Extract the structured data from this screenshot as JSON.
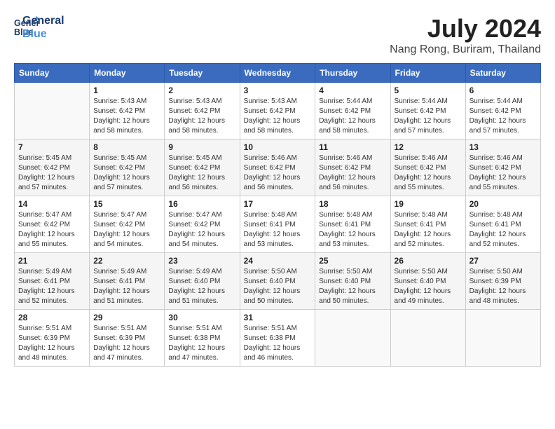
{
  "header": {
    "logo_line1": "General",
    "logo_line2": "Blue",
    "month_year": "July 2024",
    "location": "Nang Rong, Buriram, Thailand"
  },
  "columns": [
    "Sunday",
    "Monday",
    "Tuesday",
    "Wednesday",
    "Thursday",
    "Friday",
    "Saturday"
  ],
  "weeks": [
    [
      {
        "day": "",
        "sunrise": "",
        "sunset": "",
        "daylight": ""
      },
      {
        "day": "1",
        "sunrise": "Sunrise: 5:43 AM",
        "sunset": "Sunset: 6:42 PM",
        "daylight": "Daylight: 12 hours and 58 minutes."
      },
      {
        "day": "2",
        "sunrise": "Sunrise: 5:43 AM",
        "sunset": "Sunset: 6:42 PM",
        "daylight": "Daylight: 12 hours and 58 minutes."
      },
      {
        "day": "3",
        "sunrise": "Sunrise: 5:43 AM",
        "sunset": "Sunset: 6:42 PM",
        "daylight": "Daylight: 12 hours and 58 minutes."
      },
      {
        "day": "4",
        "sunrise": "Sunrise: 5:44 AM",
        "sunset": "Sunset: 6:42 PM",
        "daylight": "Daylight: 12 hours and 58 minutes."
      },
      {
        "day": "5",
        "sunrise": "Sunrise: 5:44 AM",
        "sunset": "Sunset: 6:42 PM",
        "daylight": "Daylight: 12 hours and 57 minutes."
      },
      {
        "day": "6",
        "sunrise": "Sunrise: 5:44 AM",
        "sunset": "Sunset: 6:42 PM",
        "daylight": "Daylight: 12 hours and 57 minutes."
      }
    ],
    [
      {
        "day": "7",
        "sunrise": "Sunrise: 5:45 AM",
        "sunset": "Sunset: 6:42 PM",
        "daylight": "Daylight: 12 hours and 57 minutes."
      },
      {
        "day": "8",
        "sunrise": "Sunrise: 5:45 AM",
        "sunset": "Sunset: 6:42 PM",
        "daylight": "Daylight: 12 hours and 57 minutes."
      },
      {
        "day": "9",
        "sunrise": "Sunrise: 5:45 AM",
        "sunset": "Sunset: 6:42 PM",
        "daylight": "Daylight: 12 hours and 56 minutes."
      },
      {
        "day": "10",
        "sunrise": "Sunrise: 5:46 AM",
        "sunset": "Sunset: 6:42 PM",
        "daylight": "Daylight: 12 hours and 56 minutes."
      },
      {
        "day": "11",
        "sunrise": "Sunrise: 5:46 AM",
        "sunset": "Sunset: 6:42 PM",
        "daylight": "Daylight: 12 hours and 56 minutes."
      },
      {
        "day": "12",
        "sunrise": "Sunrise: 5:46 AM",
        "sunset": "Sunset: 6:42 PM",
        "daylight": "Daylight: 12 hours and 55 minutes."
      },
      {
        "day": "13",
        "sunrise": "Sunrise: 5:46 AM",
        "sunset": "Sunset: 6:42 PM",
        "daylight": "Daylight: 12 hours and 55 minutes."
      }
    ],
    [
      {
        "day": "14",
        "sunrise": "Sunrise: 5:47 AM",
        "sunset": "Sunset: 6:42 PM",
        "daylight": "Daylight: 12 hours and 55 minutes."
      },
      {
        "day": "15",
        "sunrise": "Sunrise: 5:47 AM",
        "sunset": "Sunset: 6:42 PM",
        "daylight": "Daylight: 12 hours and 54 minutes."
      },
      {
        "day": "16",
        "sunrise": "Sunrise: 5:47 AM",
        "sunset": "Sunset: 6:42 PM",
        "daylight": "Daylight: 12 hours and 54 minutes."
      },
      {
        "day": "17",
        "sunrise": "Sunrise: 5:48 AM",
        "sunset": "Sunset: 6:41 PM",
        "daylight": "Daylight: 12 hours and 53 minutes."
      },
      {
        "day": "18",
        "sunrise": "Sunrise: 5:48 AM",
        "sunset": "Sunset: 6:41 PM",
        "daylight": "Daylight: 12 hours and 53 minutes."
      },
      {
        "day": "19",
        "sunrise": "Sunrise: 5:48 AM",
        "sunset": "Sunset: 6:41 PM",
        "daylight": "Daylight: 12 hours and 52 minutes."
      },
      {
        "day": "20",
        "sunrise": "Sunrise: 5:48 AM",
        "sunset": "Sunset: 6:41 PM",
        "daylight": "Daylight: 12 hours and 52 minutes."
      }
    ],
    [
      {
        "day": "21",
        "sunrise": "Sunrise: 5:49 AM",
        "sunset": "Sunset: 6:41 PM",
        "daylight": "Daylight: 12 hours and 52 minutes."
      },
      {
        "day": "22",
        "sunrise": "Sunrise: 5:49 AM",
        "sunset": "Sunset: 6:41 PM",
        "daylight": "Daylight: 12 hours and 51 minutes."
      },
      {
        "day": "23",
        "sunrise": "Sunrise: 5:49 AM",
        "sunset": "Sunset: 6:40 PM",
        "daylight": "Daylight: 12 hours and 51 minutes."
      },
      {
        "day": "24",
        "sunrise": "Sunrise: 5:50 AM",
        "sunset": "Sunset: 6:40 PM",
        "daylight": "Daylight: 12 hours and 50 minutes."
      },
      {
        "day": "25",
        "sunrise": "Sunrise: 5:50 AM",
        "sunset": "Sunset: 6:40 PM",
        "daylight": "Daylight: 12 hours and 50 minutes."
      },
      {
        "day": "26",
        "sunrise": "Sunrise: 5:50 AM",
        "sunset": "Sunset: 6:40 PM",
        "daylight": "Daylight: 12 hours and 49 minutes."
      },
      {
        "day": "27",
        "sunrise": "Sunrise: 5:50 AM",
        "sunset": "Sunset: 6:39 PM",
        "daylight": "Daylight: 12 hours and 48 minutes."
      }
    ],
    [
      {
        "day": "28",
        "sunrise": "Sunrise: 5:51 AM",
        "sunset": "Sunset: 6:39 PM",
        "daylight": "Daylight: 12 hours and 48 minutes."
      },
      {
        "day": "29",
        "sunrise": "Sunrise: 5:51 AM",
        "sunset": "Sunset: 6:39 PM",
        "daylight": "Daylight: 12 hours and 47 minutes."
      },
      {
        "day": "30",
        "sunrise": "Sunrise: 5:51 AM",
        "sunset": "Sunset: 6:38 PM",
        "daylight": "Daylight: 12 hours and 47 minutes."
      },
      {
        "day": "31",
        "sunrise": "Sunrise: 5:51 AM",
        "sunset": "Sunset: 6:38 PM",
        "daylight": "Daylight: 12 hours and 46 minutes."
      },
      {
        "day": "",
        "sunrise": "",
        "sunset": "",
        "daylight": ""
      },
      {
        "day": "",
        "sunrise": "",
        "sunset": "",
        "daylight": ""
      },
      {
        "day": "",
        "sunrise": "",
        "sunset": "",
        "daylight": ""
      }
    ]
  ]
}
